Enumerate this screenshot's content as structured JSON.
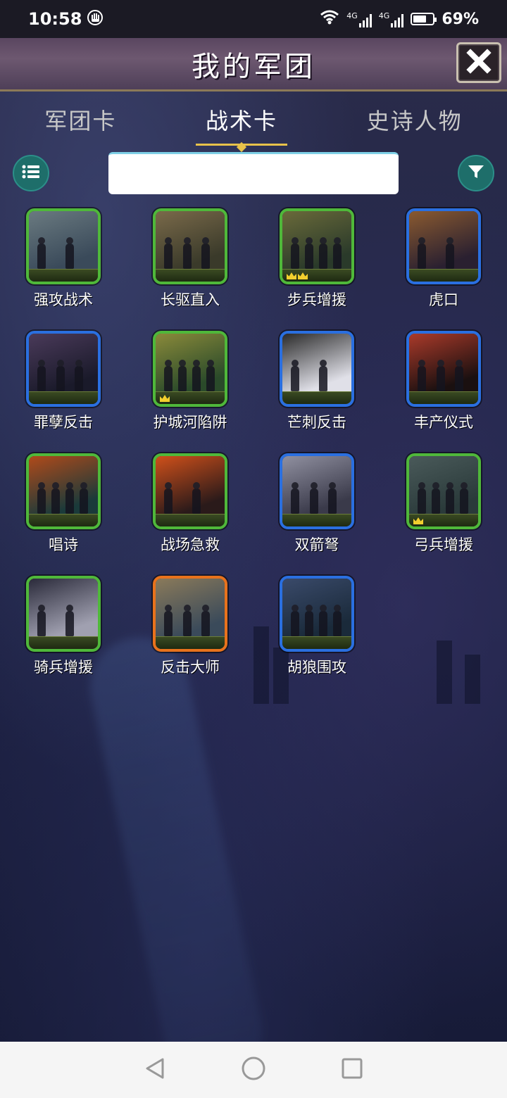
{
  "status_bar": {
    "time": "10:58",
    "network_1": "4G",
    "network_2": "4G",
    "battery": "69%",
    "battery_level": 0.69
  },
  "header": {
    "title": "我的军团",
    "close_icon": "close-x-icon"
  },
  "tabs": [
    {
      "label": "军团卡",
      "active": false
    },
    {
      "label": "战术卡",
      "active": true
    },
    {
      "label": "史诗人物",
      "active": false
    }
  ],
  "search": {
    "value": "",
    "placeholder": "",
    "list_icon": "list-icon",
    "filter_icon": "filter-icon"
  },
  "rarity_colors": {
    "green": "#4fb83a",
    "blue": "#2a6fe0",
    "orange": "#e8721c"
  },
  "cards": [
    {
      "name": "强攻战术",
      "rarity": "green",
      "crowns": 0
    },
    {
      "name": "长驱直入",
      "rarity": "green",
      "crowns": 0
    },
    {
      "name": "步兵增援",
      "rarity": "green",
      "crowns": 2
    },
    {
      "name": "虎口",
      "rarity": "blue",
      "crowns": 0
    },
    {
      "name": "罪孽反击",
      "rarity": "blue",
      "crowns": 0
    },
    {
      "name": "护城河陷阱",
      "rarity": "green",
      "crowns": 1
    },
    {
      "name": "芒刺反击",
      "rarity": "blue",
      "crowns": 0
    },
    {
      "name": "丰产仪式",
      "rarity": "blue",
      "crowns": 0
    },
    {
      "name": "唱诗",
      "rarity": "green",
      "crowns": 0
    },
    {
      "name": "战场急救",
      "rarity": "green",
      "crowns": 0
    },
    {
      "name": "双箭弩",
      "rarity": "blue",
      "crowns": 0
    },
    {
      "name": "弓兵增援",
      "rarity": "green",
      "crowns": 1
    },
    {
      "name": "骑兵增援",
      "rarity": "green",
      "crowns": 0
    },
    {
      "name": "反击大师",
      "rarity": "orange",
      "crowns": 0
    },
    {
      "name": "胡狼围攻",
      "rarity": "blue",
      "crowns": 0
    }
  ],
  "nav": {
    "back_icon": "back-triangle-icon",
    "home_icon": "home-circle-icon",
    "recents_icon": "recents-square-icon"
  }
}
